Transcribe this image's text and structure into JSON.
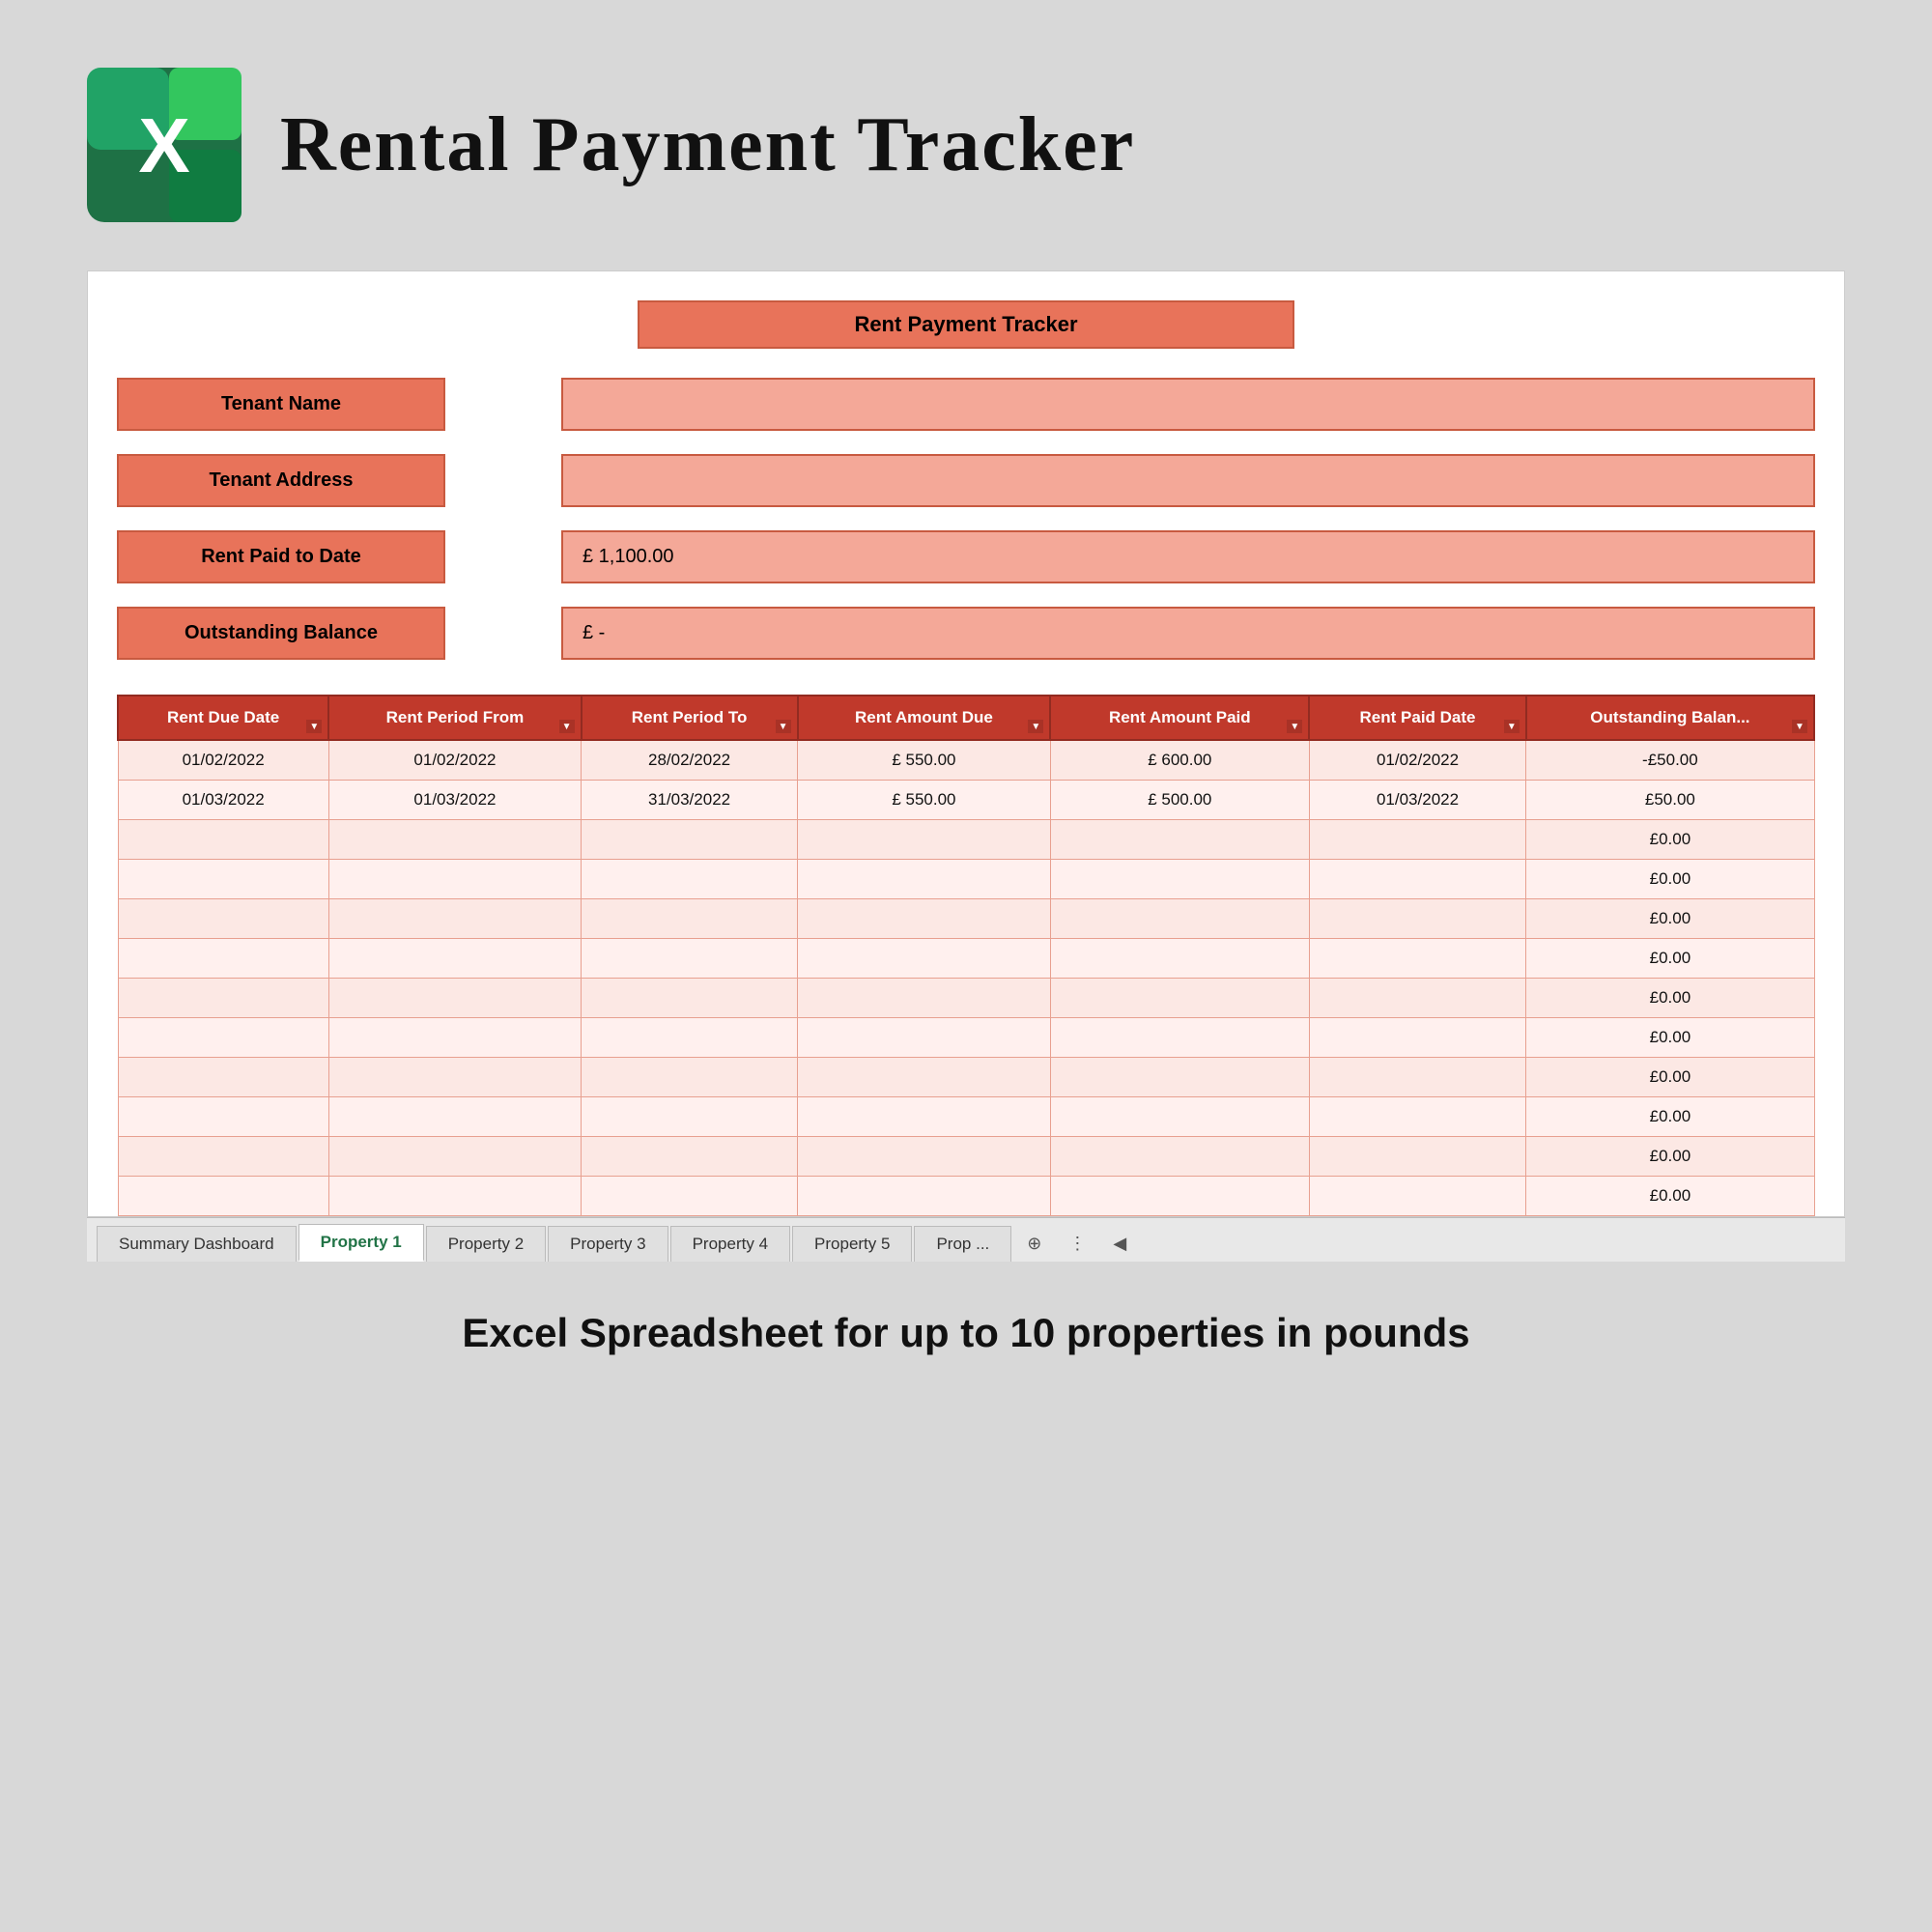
{
  "header": {
    "title": "Rental Payment Tracker",
    "footer_text": "Excel Spreadsheet for up to 10 properties in pounds"
  },
  "tracker": {
    "title": "Rent Payment Tracker",
    "fields": {
      "tenant_name_label": "Tenant Name",
      "tenant_address_label": "Tenant Address",
      "rent_paid_label": "Rent Paid to Date",
      "outstanding_label": "Outstanding Balance",
      "rent_paid_value": "£        1,100.00",
      "outstanding_value": "£         -"
    }
  },
  "table": {
    "headers": [
      "Rent Due Date",
      "Rent Period From",
      "Rent Period To",
      "Rent Amount Due",
      "Rent Amount Paid",
      "Rent Paid Date",
      "Outstanding Balan..."
    ],
    "rows": [
      [
        "01/02/2022",
        "01/02/2022",
        "28/02/2022",
        "£    550.00",
        "£    600.00",
        "01/02/2022",
        "-£50.00"
      ],
      [
        "01/03/2022",
        "01/03/2022",
        "31/03/2022",
        "£    550.00",
        "£    500.00",
        "01/03/2022",
        "£50.00"
      ],
      [
        "",
        "",
        "",
        "",
        "",
        "",
        "£0.00"
      ],
      [
        "",
        "",
        "",
        "",
        "",
        "",
        "£0.00"
      ],
      [
        "",
        "",
        "",
        "",
        "",
        "",
        "£0.00"
      ],
      [
        "",
        "",
        "",
        "",
        "",
        "",
        "£0.00"
      ],
      [
        "",
        "",
        "",
        "",
        "",
        "",
        "£0.00"
      ],
      [
        "",
        "",
        "",
        "",
        "",
        "",
        "£0.00"
      ],
      [
        "",
        "",
        "",
        "",
        "",
        "",
        "£0.00"
      ],
      [
        "",
        "",
        "",
        "",
        "",
        "",
        "£0.00"
      ],
      [
        "",
        "",
        "",
        "",
        "",
        "",
        "£0.00"
      ],
      [
        "",
        "",
        "",
        "",
        "",
        "",
        "£0.00"
      ]
    ]
  },
  "tabs": [
    {
      "label": "Summary Dashboard",
      "active": false
    },
    {
      "label": "Property 1",
      "active": true
    },
    {
      "label": "Property 2",
      "active": false
    },
    {
      "label": "Property 3",
      "active": false
    },
    {
      "label": "Property 4",
      "active": false
    },
    {
      "label": "Property 5",
      "active": false
    },
    {
      "label": "Prop ...",
      "active": false
    }
  ],
  "icons": {
    "excel_x": "X",
    "dropdown": "▼",
    "tab_add": "⊕",
    "tab_more": "⋮",
    "nav_left": "◀"
  }
}
